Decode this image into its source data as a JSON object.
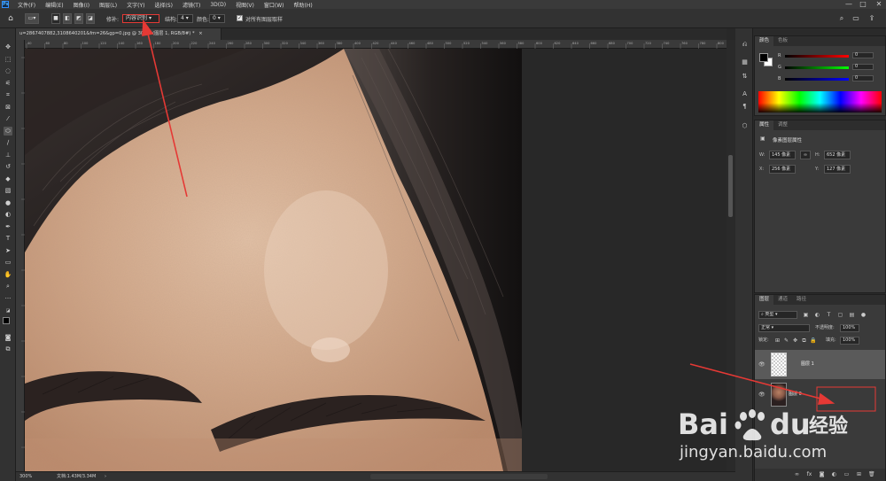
{
  "menubar": {
    "logo": "Ps",
    "items": [
      "文件(F)",
      "编辑(E)",
      "图像(I)",
      "图层(L)",
      "文字(Y)",
      "选择(S)",
      "滤镜(T)",
      "3D(D)",
      "视图(V)",
      "窗口(W)",
      "帮助(H)"
    ],
    "minimize": "—",
    "maximize": "□",
    "close": "✕"
  },
  "options": {
    "patch_label": "修补:",
    "patch_mode": "内容识别",
    "structure_label": "结构:",
    "structure_value": "4",
    "color_label": "颜色:",
    "color_value": "0",
    "sample_all_label": "对所有图层取样"
  },
  "document": {
    "tab_title": "u=2867407882,3108640201&fm=26&gp=0.jpg @ 300% (图层 1, RGB/8#) *",
    "tab_close": "×",
    "zoom": "300%",
    "doc_info": "文档:1.43M/3.34M",
    "ruler_ticks": [
      "40",
      "60",
      "80",
      "100",
      "120",
      "140",
      "160",
      "180",
      "200",
      "220",
      "240",
      "260",
      "280",
      "300",
      "320",
      "340",
      "360",
      "380",
      "400",
      "420",
      "440",
      "460",
      "480",
      "500",
      "520",
      "540",
      "560",
      "580",
      "600",
      "620",
      "640",
      "660",
      "680",
      "700",
      "720",
      "740",
      "760",
      "780",
      "800",
      "820"
    ]
  },
  "color_panel": {
    "tabs": [
      "颜色",
      "色板"
    ],
    "r_label": "R",
    "g_label": "G",
    "b_label": "B",
    "r_value": "0",
    "g_value": "0",
    "b_value": "0"
  },
  "properties_panel": {
    "tabs": [
      "属性",
      "调整"
    ],
    "section_title": "像素图层属性",
    "w_label": "W:",
    "w_value": "145 像素",
    "h_label": "H:",
    "h_value": "652 像素",
    "x_label": "X:",
    "x_value": "256 像素",
    "y_label": "Y:",
    "y_value": "127 像素",
    "link_icon": "∞"
  },
  "layers_panel": {
    "tabs": [
      "图层",
      "通道",
      "路径"
    ],
    "filter_kind": "类型",
    "blend_mode": "正常",
    "opacity_label": "不透明度:",
    "opacity_value": "100%",
    "lock_label": "锁定:",
    "fill_label": "填充:",
    "fill_value": "100%",
    "layers": [
      {
        "name": "图层 1",
        "selected": true
      },
      {
        "name": "图层 0",
        "selected": false
      }
    ]
  },
  "watermark": {
    "brand_left": "Bai",
    "brand_right": "du",
    "brand_cn": "经验",
    "url": "jingyan.baidu.com"
  },
  "annotation_colors": {
    "arrow": "#e53935",
    "box": "#e53935"
  }
}
